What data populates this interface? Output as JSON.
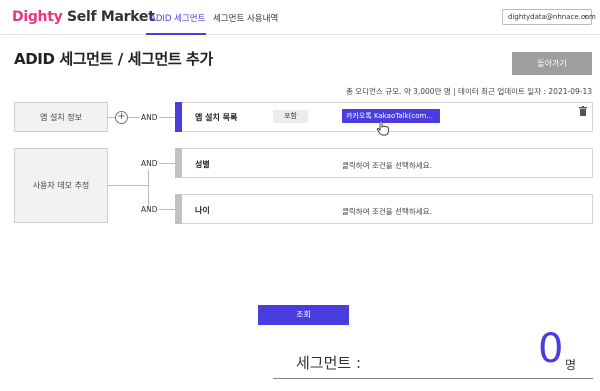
{
  "header": {
    "logo_brand": "Dighty",
    "logo_rest": " Self Market",
    "nav": [
      "ADID 세그먼트",
      "세그먼트 사용내역"
    ],
    "user_email": "dightydata@nhnace.com"
  },
  "page": {
    "title": "ADID 세그먼트 / 세그먼트 추가",
    "back_label": "돌아가기",
    "summary": "총 오디언스 규모. 약 3,000만 명 | 데이터 최근 업데이트 일자 : 2021-09-13"
  },
  "groups": [
    {
      "label": "앱 설치 정보"
    },
    {
      "label": "사용자 데모 추정"
    }
  ],
  "and_label": "AND",
  "conditions": [
    {
      "name": "앱 설치 목록",
      "include_label": "포함",
      "selected_value": "카카오톡 KakaoTalk(com...",
      "active": true
    },
    {
      "name": "성별",
      "hint": "클릭하여 조건을 선택하세요."
    },
    {
      "name": "나이",
      "hint": "클릭하여 조건을 선택하세요."
    }
  ],
  "query_label": "조회",
  "segment": {
    "label": "세그먼트 :",
    "count": "0",
    "unit": "명"
  },
  "colors": {
    "accent": "#4a3de0",
    "brand": "#e8367f",
    "button_gray": "#9e9e9e"
  },
  "icons": [
    "trash-icon",
    "plus-circle-icon",
    "chevron-down-icon",
    "hand-cursor-icon"
  ]
}
